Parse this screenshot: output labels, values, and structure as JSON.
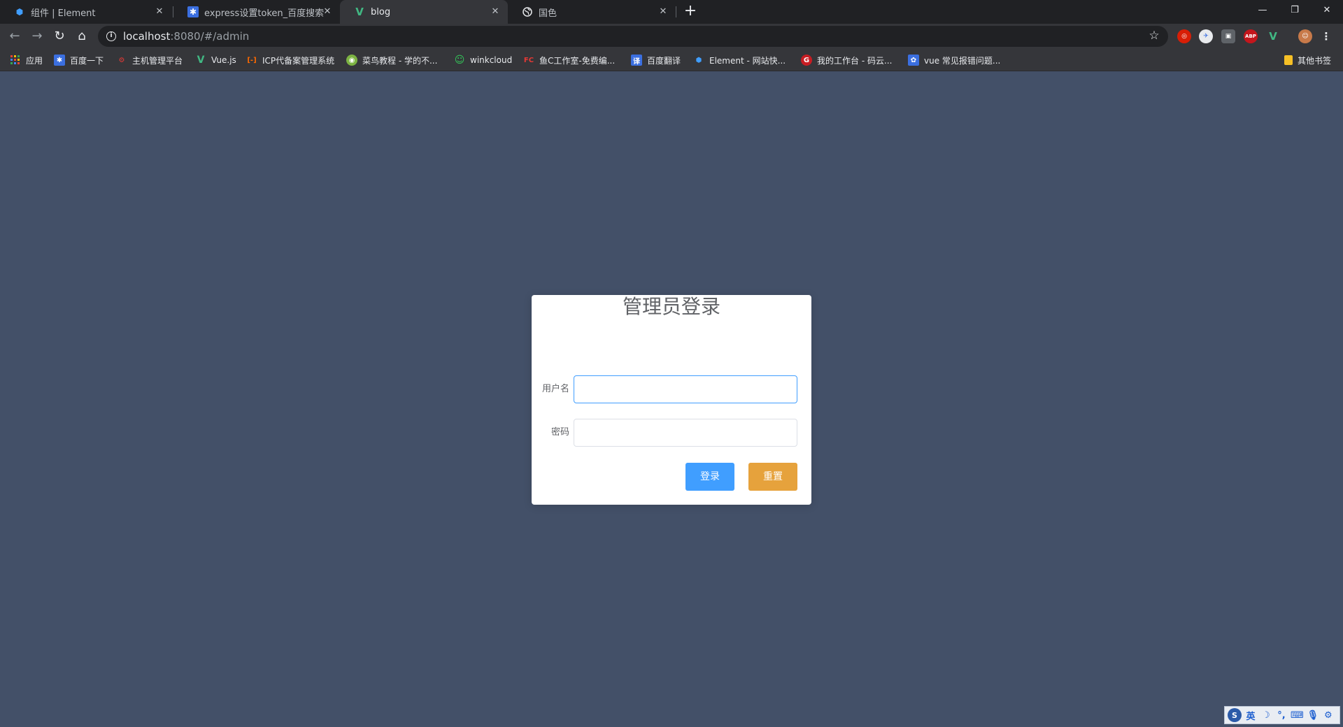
{
  "tabs": [
    {
      "title": "组件 | Element",
      "icon": "element-logo-icon",
      "active": false
    },
    {
      "title": "express设置token_百度搜索",
      "icon": "baidu-paw-icon",
      "active": false
    },
    {
      "title": "blog",
      "icon": "vue-logo-icon",
      "active": true
    },
    {
      "title": "国色",
      "icon": "globe-icon",
      "active": false
    }
  ],
  "address_bar": {
    "host": "localhost",
    "path": ":8080/#/admin"
  },
  "bookmarks": [
    {
      "label": "应用",
      "icon": "apps-grid-icon"
    },
    {
      "label": "百度一下",
      "icon": "baidu-paw-icon"
    },
    {
      "label": "主机管理平台",
      "icon": "host-panel-icon"
    },
    {
      "label": "Vue.js",
      "icon": "vue-logo-icon"
    },
    {
      "label": "ICP代备案管理系统",
      "icon": "aliyun-icon"
    },
    {
      "label": "菜鸟教程 - 学的不...",
      "icon": "runoob-icon"
    },
    {
      "label": "winkcloud",
      "icon": "smiley-icon"
    },
    {
      "label": "鱼C工作室-免费编...",
      "icon": "fishc-icon"
    },
    {
      "label": "百度翻译",
      "icon": "baidu-translate-icon"
    },
    {
      "label": "Element - 网站快...",
      "icon": "element-logo-icon"
    },
    {
      "label": "我的工作台 - 码云...",
      "icon": "gitee-icon"
    },
    {
      "label": "vue 常见报错问题...",
      "icon": "vue-tips-icon"
    }
  ],
  "other_bookmarks": "其他书签",
  "login": {
    "title": "管理员登录",
    "username_label": "用户名",
    "username_value": "",
    "password_label": "密码",
    "password_value": "",
    "login_button": "登录",
    "reset_button": "重置"
  },
  "colors": {
    "page_bg": "#435068",
    "primary": "#409eff",
    "warning": "#e6a23c",
    "card_bg": "#ffffff"
  },
  "ime": {
    "mode": "英"
  }
}
